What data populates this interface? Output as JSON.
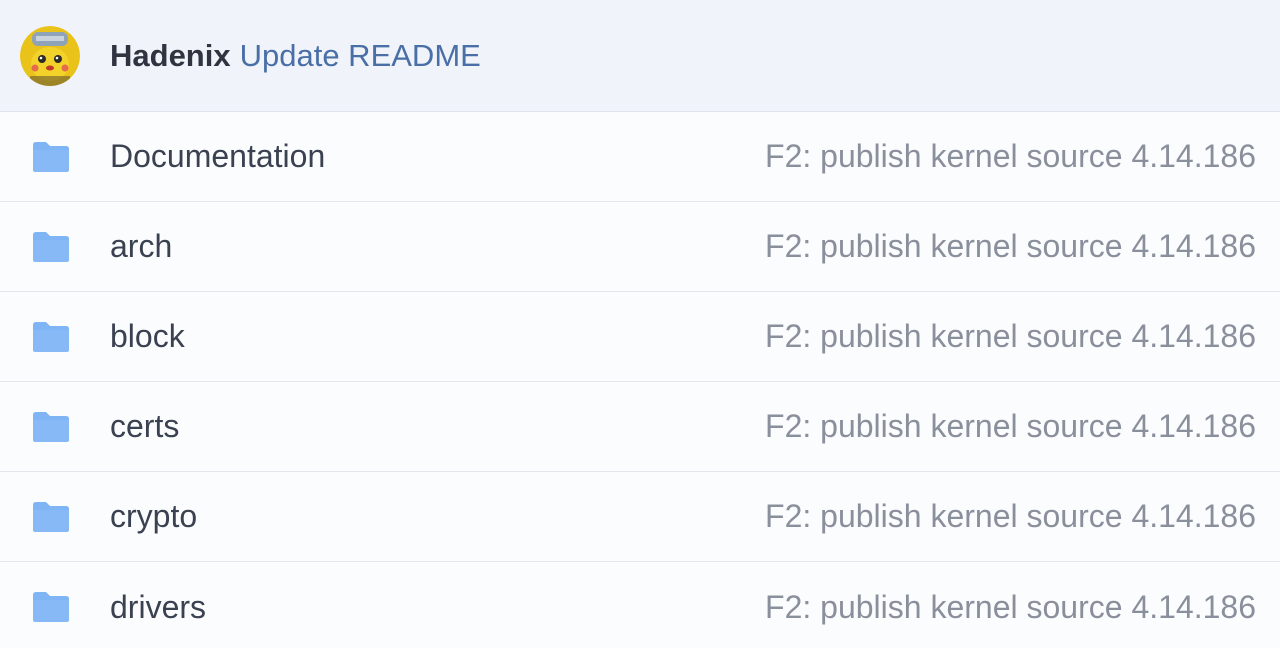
{
  "header": {
    "author": "Hadenix",
    "message": "Update README"
  },
  "colors": {
    "folder": "#7fb4f5",
    "header_bg": "#f0f4fa",
    "message": "#4a6fa6"
  },
  "files": [
    {
      "name": "Documentation",
      "icon": "folder-icon",
      "commit": "F2: publish kernel source 4.14.186"
    },
    {
      "name": "arch",
      "icon": "folder-icon",
      "commit": "F2: publish kernel source 4.14.186"
    },
    {
      "name": "block",
      "icon": "folder-icon",
      "commit": "F2: publish kernel source 4.14.186"
    },
    {
      "name": "certs",
      "icon": "folder-icon",
      "commit": "F2: publish kernel source 4.14.186"
    },
    {
      "name": "crypto",
      "icon": "folder-icon",
      "commit": "F2: publish kernel source 4.14.186"
    },
    {
      "name": "drivers",
      "icon": "folder-icon",
      "commit": "F2: publish kernel source 4.14.186"
    }
  ]
}
